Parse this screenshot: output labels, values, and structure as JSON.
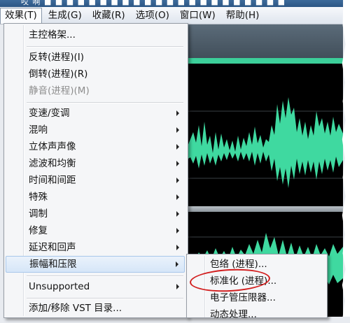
{
  "window": {
    "title": "哎 啊 ■ ■ ■ ■ ■ ■ ■ ■ ■ ■ ■ ■ ■ ■ ■ ■ ■ ■ ■ ■ ■ ■"
  },
  "menubar": {
    "items": [
      {
        "label": "效果(T)",
        "active": true
      },
      {
        "label": "生成(G)"
      },
      {
        "label": "收藏(R)"
      },
      {
        "label": "选项(O)"
      },
      {
        "label": "窗口(W)"
      },
      {
        "label": "帮助(H)"
      }
    ]
  },
  "effects_menu": {
    "items": [
      {
        "label": "主控格架..."
      },
      {
        "label": "反转(进程)(I)"
      },
      {
        "label": "倒转(进程)(R)"
      },
      {
        "label": "静音(进程)(M)",
        "disabled": true
      },
      {
        "label": "变速/变调",
        "submenu": true
      },
      {
        "label": "混响",
        "submenu": true
      },
      {
        "label": "立体声声像",
        "submenu": true
      },
      {
        "label": "滤波和均衡",
        "submenu": true
      },
      {
        "label": "时间和间距",
        "submenu": true
      },
      {
        "label": "特殊",
        "submenu": true
      },
      {
        "label": "调制",
        "submenu": true
      },
      {
        "label": "修复",
        "submenu": true
      },
      {
        "label": "延迟和回声",
        "submenu": true
      },
      {
        "label": "振幅和压限",
        "submenu": true,
        "hover": true
      },
      {
        "label": "Unsupported",
        "submenu": true
      },
      {
        "label": "添加/移除 VST 目录..."
      }
    ]
  },
  "amplitude_submenu": {
    "items": [
      {
        "label": "包络 (进程)..."
      },
      {
        "label": "标准化 (进程)..."
      },
      {
        "label": "电子管压限器..."
      },
      {
        "label": "动态处理..."
      }
    ]
  },
  "colors": {
    "waveform": "#3fd9a0",
    "highlight_circle": "#d21f1f"
  }
}
